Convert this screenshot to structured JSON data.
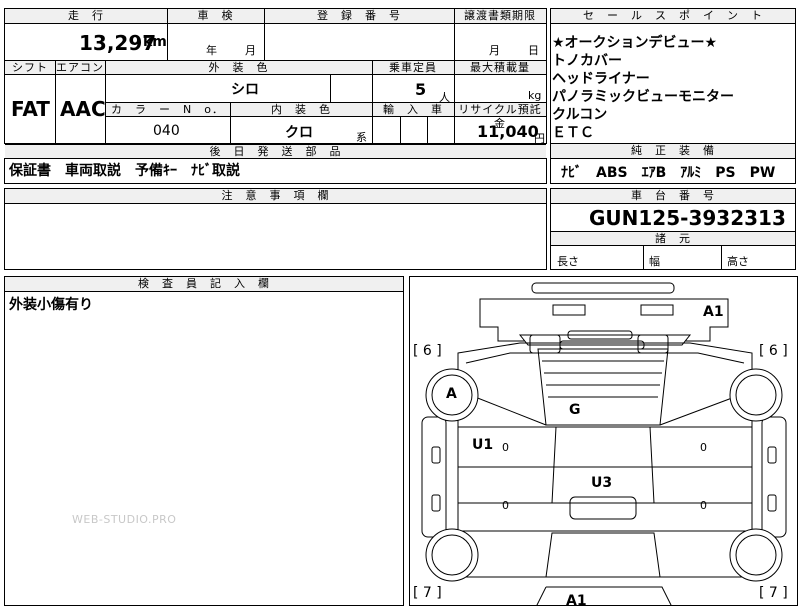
{
  "top_form": {
    "headers": {
      "mileage": "走　行",
      "inspection": "車　検",
      "registration_no": "登　録　番　号",
      "transfer_deadline": "譲渡書類期限",
      "shift": "シフト",
      "aircon": "エアコン",
      "exterior_color": "外　装　色",
      "capacity": "乗車定員",
      "max_load": "最大積載量",
      "color_no": "カ　ラ　ー　N　o．",
      "interior_color": "内　装　色",
      "import": "輸　入　車",
      "recycle": "リサイクル預託金",
      "later_parts": "後　日　発　送　部　品"
    },
    "mileage_value": "13,297",
    "mileage_unit": "km",
    "inspection_year_unit": "年",
    "inspection_month_unit": "月",
    "transfer_month_unit": "月",
    "transfer_day_unit": "日",
    "shift_value": "FAT",
    "aircon_value": "AAC",
    "exterior_color_value": "シロ",
    "capacity_value": "5",
    "capacity_unit": "人",
    "max_load_unit": "kg",
    "color_no_value": "040",
    "interior_color_value": "クロ",
    "interior_color_suffix": "系",
    "recycle_value": "11,040",
    "recycle_unit": "円",
    "later_parts_value": "保証書　車両取説　予備ｷｰ　ﾅﾋﾞ取説"
  },
  "sales_points": {
    "header": "セ　ー　ル　ス　ポ　イ　ン　ト",
    "items": [
      "★オークションデビュー★",
      "トノカバー",
      "ヘッドライナー",
      "パノラミックビューモニター",
      "クルコン",
      "ＥＴＣ"
    ]
  },
  "genuine_equipment": {
    "header": "純　正　装　備",
    "value": "ﾅﾋﾞ　ABS　ｴｱB　ｱﾙﾐ　PS　PW"
  },
  "notes": {
    "header": "注　意　事　項　欄",
    "value": ""
  },
  "chassis": {
    "header": "車　台　番　号",
    "value": "GUN125-3932313",
    "dims_header": "諸　元",
    "length": "長さ",
    "width": "幅",
    "height": "高さ"
  },
  "inspector": {
    "header": "検　査　員　記　入　欄",
    "value": "外装小傷有り"
  },
  "diagram": {
    "labels": {
      "a1_top": "A1",
      "left_6": "[ 6 ]",
      "right_6": "[ 6 ]",
      "a": "A",
      "g": "G",
      "u1": "U1",
      "u3": "U3",
      "zero1": "0",
      "zero2": "0",
      "zero3": "0",
      "zero4": "0",
      "left_7": "[ 7 ]",
      "right_7": "[ 7 ]",
      "a1_bottom": "A1"
    }
  },
  "watermark": "WEB-STUDIO.PRO"
}
